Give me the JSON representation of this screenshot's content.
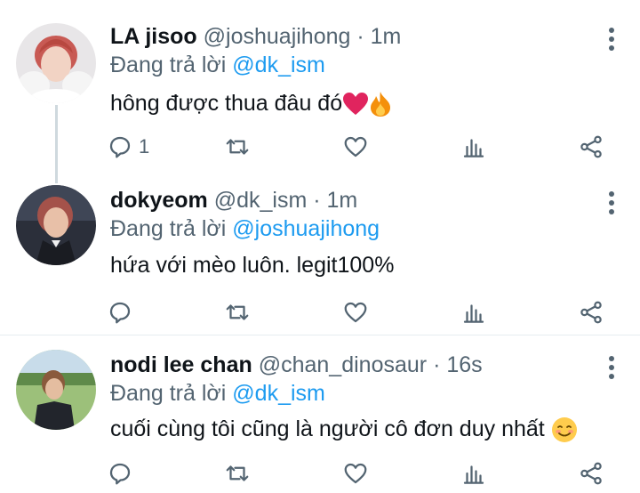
{
  "tweets": [
    {
      "name": "LA jisoo",
      "handle": "@joshuajihong",
      "dot": "·",
      "time": "1m",
      "reply_prefix": "Đang trả lời ",
      "reply_to": "@dk_ism",
      "text": "hông được thua đâu đó",
      "text_emojis": [
        "heart-emoji",
        "fire-emoji"
      ],
      "reply_count": "1"
    },
    {
      "name": "dokyeom",
      "handle": "@dk_ism",
      "dot": "·",
      "time": "1m",
      "reply_prefix": "Đang trả lời ",
      "reply_to": "@joshuajihong",
      "text": "hứa với mèo luôn. legit100%",
      "reply_count": ""
    },
    {
      "name": "nodi lee chan",
      "handle": "@chan_dinosaur",
      "dot": "·",
      "time": "16s",
      "reply_prefix": "Đang trả lời ",
      "reply_to": "@dk_ism",
      "text": "cuối cùng tôi cũng là người cô đơn duy nhất",
      "text_emojis": [
        "smiling-emoji"
      ],
      "reply_count": ""
    }
  ],
  "icons": [
    "reply-icon",
    "retweet-icon",
    "like-icon",
    "stats-icon",
    "share-icon",
    "more-icon"
  ],
  "colors": {
    "text": "#0f1419",
    "secondary": "#536471",
    "mention": "#1d9bf0",
    "thread_line": "#cfd9de",
    "heart": "#e0245e",
    "fire": "#f4900c"
  }
}
